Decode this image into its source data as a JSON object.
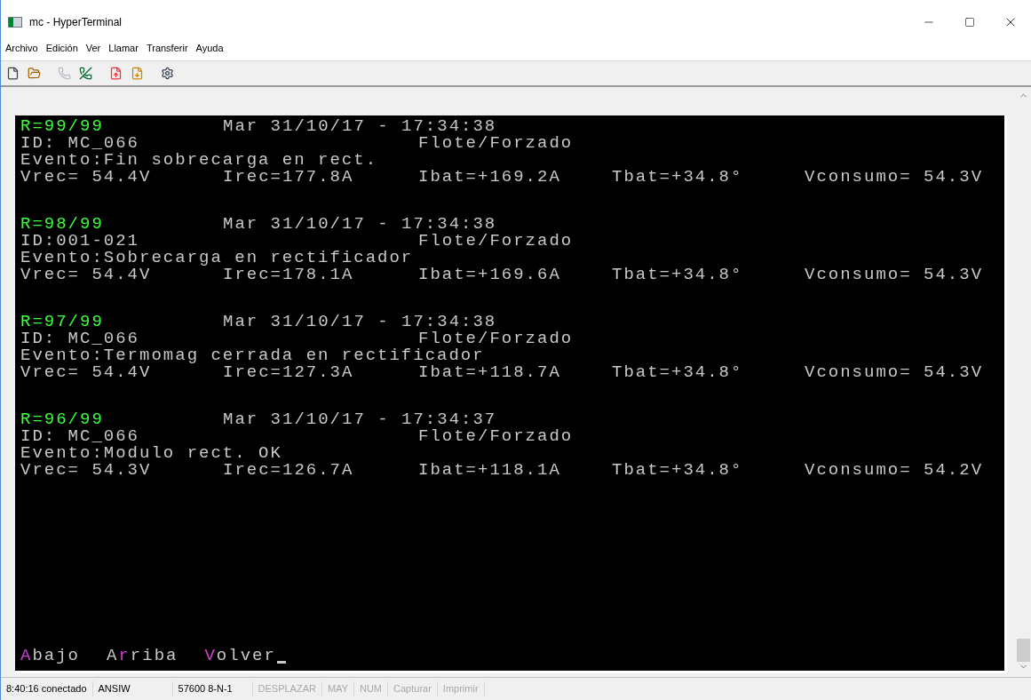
{
  "window": {
    "title": "mc - HyperTerminal"
  },
  "menu": [
    "Archivo",
    "Edición",
    "Ver",
    "Llamar",
    "Transferir",
    "Ayuda"
  ],
  "toolbar": [
    {
      "kind": "new",
      "disabled": false
    },
    {
      "kind": "open",
      "disabled": false
    },
    {
      "kind": "call",
      "disabled": true
    },
    {
      "kind": "hangup",
      "disabled": false
    },
    {
      "kind": "send",
      "disabled": false
    },
    {
      "kind": "receive",
      "disabled": false
    },
    {
      "kind": "properties",
      "disabled": false
    }
  ],
  "records": [
    {
      "record": "R=99/99",
      "datetime": "Mar 31/10/17 - 17:34:38",
      "id": "ID: MC_066",
      "mode": "Flote/Forzado",
      "event": "Evento:Fin sobrecarga en rect.",
      "vrec": "Vrec= 54.4V",
      "irec": "Irec=177.8A",
      "ibat": "Ibat=+169.2A",
      "tbat": "Tbat=+34.8°",
      "vconsumo": "Vconsumo= 54.3V"
    },
    {
      "record": "R=98/99",
      "datetime": "Mar 31/10/17 - 17:34:38",
      "id": "ID:001-021",
      "mode": "Flote/Forzado",
      "event": "Evento:Sobrecarga en rectificador",
      "vrec": "Vrec= 54.4V",
      "irec": "Irec=178.1A",
      "ibat": "Ibat=+169.6A",
      "tbat": "Tbat=+34.8°",
      "vconsumo": "Vconsumo= 54.3V"
    },
    {
      "record": "R=97/99",
      "datetime": "Mar 31/10/17 - 17:34:38",
      "id": "ID: MC_066",
      "mode": "Flote/Forzado",
      "event": "Evento:Termomag cerrada en rectificador",
      "vrec": "Vrec= 54.4V",
      "irec": "Irec=127.3A",
      "ibat": "Ibat=+118.7A",
      "tbat": "Tbat=+34.8°",
      "vconsumo": "Vconsumo= 54.3V"
    },
    {
      "record": "R=96/99",
      "datetime": "Mar 31/10/17 - 17:34:37",
      "id": "ID: MC_066",
      "mode": "Flote/Forzado",
      "event": "Evento:Modulo rect. OK",
      "vrec": "Vrec= 54.3V",
      "irec": "Irec=126.7A",
      "ibat": "Ibat=+118.1A",
      "tbat": "Tbat=+34.8°",
      "vconsumo": "Vconsumo= 54.2V"
    }
  ],
  "commands": [
    {
      "hotkey": "A",
      "after": "bajo"
    },
    {
      "before": "A",
      "hotkey": "r",
      "after": "riba"
    },
    {
      "hotkey": "V",
      "after": "olver"
    }
  ],
  "status_bar": [
    {
      "text": "8:40:16 conectado",
      "disabled": false
    },
    {
      "text": "ANSIW",
      "disabled": false
    },
    {
      "text": "57600 8-N-1",
      "disabled": false
    },
    {
      "text": "DESPLAZAR",
      "disabled": true
    },
    {
      "text": "MAY",
      "disabled": true
    },
    {
      "text": "NUM",
      "disabled": true
    },
    {
      "text": "Capturar",
      "disabled": true
    },
    {
      "text": "Imprimir",
      "disabled": true
    }
  ]
}
